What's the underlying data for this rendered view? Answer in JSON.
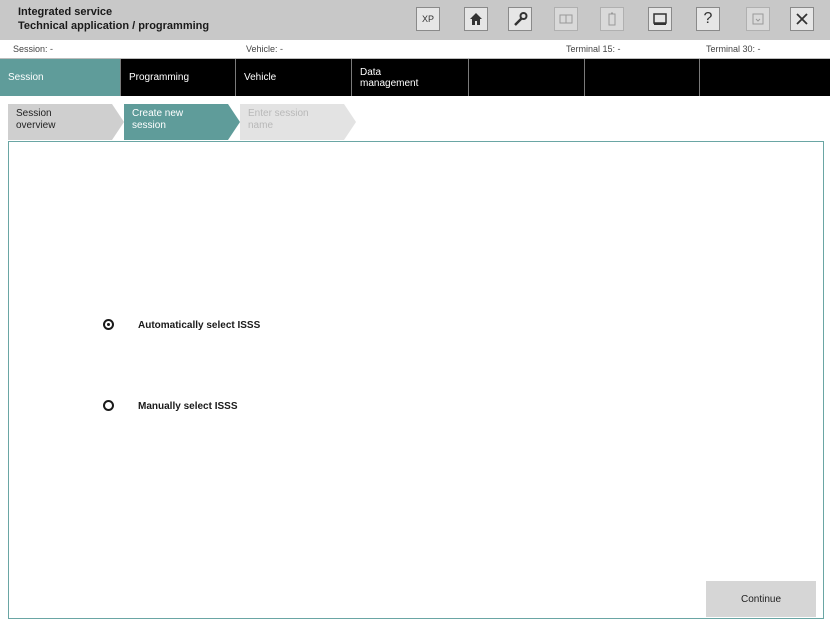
{
  "header": {
    "title_line1": "Integrated service",
    "title_line2": "Technical application / programming",
    "toolbar": [
      {
        "icon": "xp-icon",
        "label": "XP"
      },
      {
        "icon": "home-icon"
      },
      {
        "icon": "wrench-icon"
      },
      {
        "icon": "card-icon"
      },
      {
        "icon": "battery-icon"
      },
      {
        "icon": "print-icon"
      },
      {
        "icon": "help-icon",
        "label": "?"
      },
      {
        "icon": "minimize-icon"
      },
      {
        "icon": "close-icon"
      }
    ]
  },
  "status": {
    "session": "Session:  -",
    "vehicle": "Vehicle:  -",
    "terminal15": "Terminal 15:  -",
    "terminal30": "Terminal 30:  -"
  },
  "nav": {
    "session": "Session",
    "programming": "Programming",
    "vehicle": "Vehicle",
    "data_line1": "Data",
    "data_line2": "management"
  },
  "tabs": {
    "overview_line1": "Session",
    "overview_line2": "overview",
    "create_line1": "Create new",
    "create_line2": "session",
    "enter_line1": "Enter session",
    "enter_line2": "name"
  },
  "options": {
    "auto": "Automatically select ISSS",
    "manual": "Manually select ISSS",
    "selected": "auto"
  },
  "footer": {
    "continue": "Continue"
  }
}
